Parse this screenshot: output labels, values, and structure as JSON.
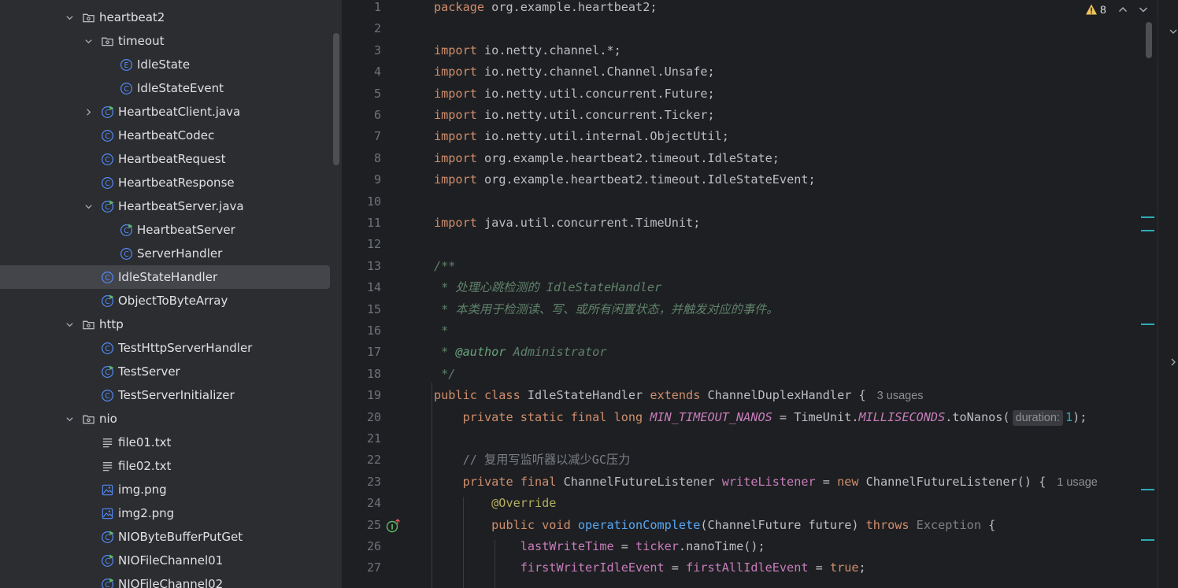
{
  "project_tree": {
    "items": [
      {
        "label": "heartbeat2",
        "type": "package",
        "depth": 0,
        "expanded": true
      },
      {
        "label": "timeout",
        "type": "package",
        "depth": 1,
        "expanded": true
      },
      {
        "label": "IdleState",
        "type": "enum",
        "depth": 2
      },
      {
        "label": "IdleStateEvent",
        "type": "class",
        "depth": 2
      },
      {
        "label": "HeartbeatClient.java",
        "type": "runnable-class",
        "depth": 1,
        "expanded": false
      },
      {
        "label": "HeartbeatCodec",
        "type": "class",
        "depth": 1
      },
      {
        "label": "HeartbeatRequest",
        "type": "class",
        "depth": 1
      },
      {
        "label": "HeartbeatResponse",
        "type": "class",
        "depth": 1
      },
      {
        "label": "HeartbeatServer.java",
        "type": "runnable-class",
        "depth": 1,
        "expanded": true
      },
      {
        "label": "HeartbeatServer",
        "type": "runnable-class",
        "depth": 2
      },
      {
        "label": "ServerHandler",
        "type": "class",
        "depth": 2
      },
      {
        "label": "IdleStateHandler",
        "type": "class",
        "depth": 1,
        "selected": true
      },
      {
        "label": "ObjectToByteArray",
        "type": "runnable-class",
        "depth": 1
      },
      {
        "label": "http",
        "type": "package",
        "depth": 0,
        "expanded": true
      },
      {
        "label": "TestHttpServerHandler",
        "type": "class",
        "depth": 1
      },
      {
        "label": "TestServer",
        "type": "runnable-class",
        "depth": 1
      },
      {
        "label": "TestServerInitializer",
        "type": "class",
        "depth": 1
      },
      {
        "label": "nio",
        "type": "package",
        "depth": 0,
        "expanded": true
      },
      {
        "label": "file01.txt",
        "type": "text-file",
        "depth": 1
      },
      {
        "label": "file02.txt",
        "type": "text-file",
        "depth": 1
      },
      {
        "label": "img.png",
        "type": "image-file",
        "depth": 1
      },
      {
        "label": "img2.png",
        "type": "image-file",
        "depth": 1
      },
      {
        "label": "NIOByteBufferPutGet",
        "type": "runnable-class",
        "depth": 1
      },
      {
        "label": "NIOFileChannel01",
        "type": "runnable-class",
        "depth": 1
      },
      {
        "label": "NIOFileChannel02",
        "type": "runnable-class",
        "depth": 1
      }
    ]
  },
  "editor": {
    "warning_count": "8",
    "lines": [
      {
        "n": "1",
        "tokens": [
          [
            "kw",
            "package"
          ],
          [
            "",
            "org.example.heartbeat2;"
          ]
        ]
      },
      {
        "n": "2",
        "tokens": []
      },
      {
        "n": "3",
        "tokens": [
          [
            "kw",
            "import"
          ],
          [
            "",
            "io.netty.channel.*;"
          ]
        ]
      },
      {
        "n": "4",
        "tokens": [
          [
            "kw",
            "import"
          ],
          [
            "",
            "io.netty.channel.Channel.Unsafe;"
          ]
        ]
      },
      {
        "n": "5",
        "tokens": [
          [
            "kw",
            "import"
          ],
          [
            "",
            "io.netty.util.concurrent.Future;"
          ]
        ]
      },
      {
        "n": "6",
        "tokens": [
          [
            "kw",
            "import"
          ],
          [
            "",
            "io.netty.util.concurrent.Ticker;"
          ]
        ]
      },
      {
        "n": "7",
        "tokens": [
          [
            "kw",
            "import"
          ],
          [
            "",
            "io.netty.util.internal.ObjectUtil;"
          ]
        ]
      },
      {
        "n": "8",
        "tokens": [
          [
            "kw",
            "import"
          ],
          [
            "",
            "org.example.heartbeat2.timeout.IdleState;"
          ]
        ]
      },
      {
        "n": "9",
        "tokens": [
          [
            "kw",
            "import"
          ],
          [
            "",
            "org.example.heartbeat2.timeout.IdleStateEvent;"
          ]
        ]
      },
      {
        "n": "10",
        "tokens": []
      },
      {
        "n": "11",
        "tokens": [
          [
            "kw",
            "import"
          ],
          [
            "",
            "java.util.concurrent.TimeUnit;"
          ]
        ]
      },
      {
        "n": "12",
        "tokens": []
      },
      {
        "n": "13",
        "tokens": [
          [
            "doc",
            "/**"
          ]
        ]
      },
      {
        "n": "14",
        "tokens": [
          [
            "doc",
            " * 处理心跳检测的 IdleStateHandler"
          ]
        ]
      },
      {
        "n": "15",
        "tokens": [
          [
            "doc",
            " * 本类用于检测读、写、或所有闲置状态，并触发对应的事件。"
          ]
        ]
      },
      {
        "n": "16",
        "tokens": [
          [
            "doc",
            " *"
          ]
        ]
      },
      {
        "n": "17",
        "tokens": [
          [
            "doc",
            " * "
          ],
          [
            "doctag",
            "@author"
          ],
          [
            "doc",
            " Administrator"
          ]
        ]
      },
      {
        "n": "18",
        "tokens": [
          [
            "doc",
            " */"
          ]
        ]
      },
      {
        "n": "19",
        "tokens": [
          [
            "kw",
            "public class"
          ],
          [
            "",
            " IdleStateHandler "
          ],
          [
            "kw",
            "extends"
          ],
          [
            "",
            " ChannelDuplexHandler {"
          ],
          [
            "hint",
            "3 usages"
          ]
        ]
      },
      {
        "n": "20",
        "tokens": [
          [
            "",
            "    "
          ],
          [
            "kw",
            "private static final long"
          ],
          [
            "",
            ""
          ],
          [
            "cst",
            " MIN_TIMEOUT_NANOS"
          ],
          [
            "",
            " = TimeUnit."
          ],
          [
            "cst",
            "MILLISECONDS"
          ],
          [
            "",
            ".toNanos("
          ],
          [
            "inlay",
            "duration:"
          ],
          [
            "num",
            "1"
          ],
          [
            "",
            ");"
          ]
        ]
      },
      {
        "n": "21",
        "tokens": []
      },
      {
        "n": "22",
        "tokens": [
          [
            "cm",
            "    // 复用写监听器以减少GC压力"
          ]
        ]
      },
      {
        "n": "23",
        "tokens": [
          [
            "",
            "    "
          ],
          [
            "kw",
            "private final"
          ],
          [
            "",
            " ChannelFutureListener "
          ],
          [
            "fld",
            "writeListener"
          ],
          [
            "",
            " = "
          ],
          [
            "kw",
            "new"
          ],
          [
            "",
            " ChannelFutureListener() {"
          ],
          [
            "hint",
            "1 usage"
          ]
        ]
      },
      {
        "n": "24",
        "tokens": [
          [
            "",
            "        "
          ],
          [
            "ann",
            "@Override"
          ]
        ]
      },
      {
        "n": "25",
        "tokens": [
          [
            "",
            "        "
          ],
          [
            "kw",
            "public void"
          ],
          [
            "fn",
            " operationComplete"
          ],
          [
            "",
            "(ChannelFuture future) "
          ],
          [
            "kw",
            "throws"
          ],
          [
            "exc",
            " Exception"
          ],
          [
            "",
            " {"
          ]
        ]
      },
      {
        "n": "26",
        "tokens": [
          [
            "",
            "            "
          ],
          [
            "fld",
            "lastWriteTime"
          ],
          [
            "",
            " = "
          ],
          [
            "fld",
            "ticker"
          ],
          [
            "",
            ".nanoTime();"
          ]
        ]
      },
      {
        "n": "27",
        "tokens": [
          [
            "",
            "            "
          ],
          [
            "fld",
            "firstWriterIdleEvent"
          ],
          [
            "",
            " = "
          ],
          [
            "fld",
            "firstAllIdleEvent"
          ],
          [
            "",
            " = "
          ],
          [
            "kw",
            "true"
          ],
          [
            "",
            ";"
          ]
        ]
      }
    ]
  },
  "colors": {
    "background": "#1e1f22",
    "sidebar": "#2b2d30",
    "selection": "#43454a",
    "keyword": "#cf8e6d",
    "doc_comment": "#5f826b",
    "field": "#c77dbb",
    "method": "#56a8f5",
    "number": "#2aacb8",
    "class_icon": "#548af7",
    "warning": "#f2c55c"
  }
}
